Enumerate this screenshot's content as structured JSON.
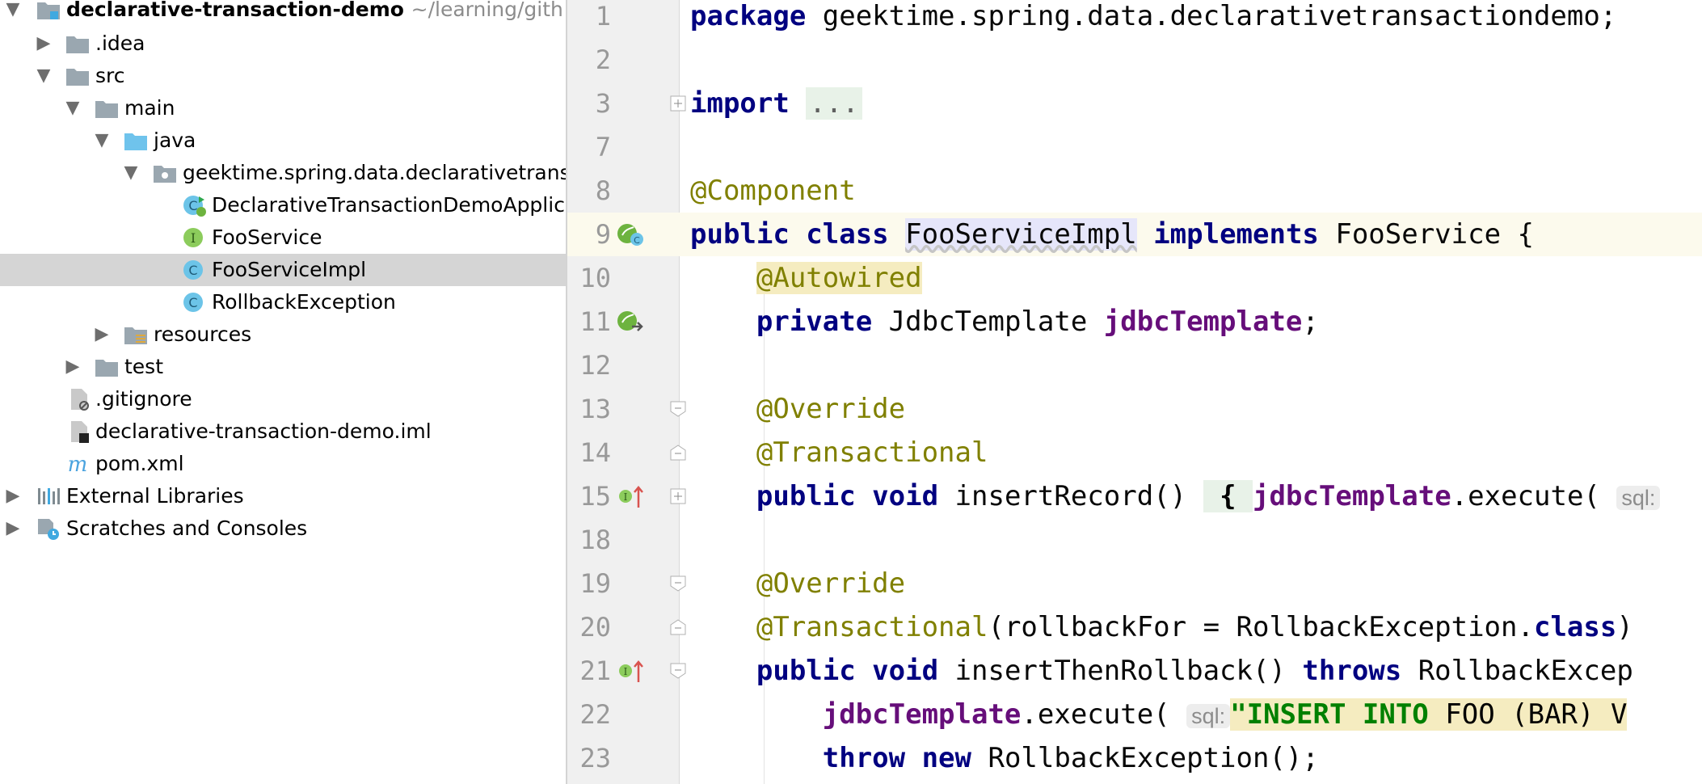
{
  "project_tree": {
    "root": {
      "name": "declarative-transaction-demo",
      "path": "~/learning/gith"
    },
    "items": [
      {
        "label": "declarative-transaction-demo",
        "icon": "module-folder-icon"
      },
      {
        "label": ".idea",
        "icon": "folder-icon"
      },
      {
        "label": "src",
        "icon": "folder-icon"
      },
      {
        "label": "main",
        "icon": "folder-icon"
      },
      {
        "label": "java",
        "icon": "source-folder-icon"
      },
      {
        "label": "geektime.spring.data.declarativetrans",
        "icon": "package-icon"
      },
      {
        "label": "DeclarativeTransactionDemoApplic",
        "icon": "spring-boot-class-icon"
      },
      {
        "label": "FooService",
        "icon": "interface-icon"
      },
      {
        "label": "FooServiceImpl",
        "icon": "class-icon"
      },
      {
        "label": "RollbackException",
        "icon": "class-icon"
      },
      {
        "label": "resources",
        "icon": "resources-folder-icon"
      },
      {
        "label": "test",
        "icon": "folder-icon"
      },
      {
        "label": ".gitignore",
        "icon": "ignored-file-icon"
      },
      {
        "label": "declarative-transaction-demo.iml",
        "icon": "iml-file-icon"
      },
      {
        "label": "pom.xml",
        "icon": "maven-icon"
      },
      {
        "label": "External Libraries",
        "icon": "libraries-icon"
      },
      {
        "label": "Scratches and Consoles",
        "icon": "scratches-icon"
      }
    ]
  },
  "editor": {
    "line_numbers": [
      "1",
      "2",
      "3",
      "7",
      "8",
      "9",
      "10",
      "11",
      "12",
      "13",
      "14",
      "15",
      "18",
      "19",
      "20",
      "21",
      "22",
      "23"
    ],
    "code": {
      "l1_kw": "package",
      "l1_rest": " geektime.spring.data.declarativetransactiondemo;",
      "l3_kw": "import",
      "l3_fold": "...",
      "l8_ann": "@Component",
      "l9_kw1": "public class",
      "l9_cls": "FooServiceImpl",
      "l9_kw2": "implements",
      "l9_rest": " FooService {",
      "l10_ann": "@Autowired",
      "l11_kw": "private",
      "l11_type": " JdbcTemplate ",
      "l11_fld": "jdbcTemplate",
      "l11_end": ";",
      "l13_ann": "@Override",
      "l14_ann": "@Transactional",
      "l15_kw": "public void",
      "l15_name": " insertRecord() ",
      "l15_brace": "{",
      "l15_fld": "jdbcTemplate",
      "l15_call": ".execute( ",
      "l15_hint": "sql:",
      "l19_ann": "@Override",
      "l20_ann": "@Transactional",
      "l20_args1": "(rollbackFor = RollbackException.",
      "l20_kw": "class",
      "l20_args2": ")",
      "l21_kw1": "public void",
      "l21_name": " insertThenRollback() ",
      "l21_kw2": "throws",
      "l21_rest": " RollbackExcep",
      "l22_fld": "jdbcTemplate",
      "l22_call": ".execute( ",
      "l22_hint": "sql:",
      "l22_str": "\"INSERT INTO",
      "l22_str2": " FOO (BAR) V",
      "l23_kw": "throw new",
      "l23_rest": " RollbackException();"
    },
    "gutter_icons": {
      "l9": "spring-bean-icon",
      "l11": "autowired-navigation-icon",
      "l15": "implements-method-icon",
      "l21": "implements-method-icon"
    }
  },
  "colors": {
    "keyword": "#000080",
    "annotation": "#808000",
    "field": "#660e7a",
    "string": "#008000",
    "selection": "#d5d5d5",
    "current_line": "#fcfaed"
  }
}
